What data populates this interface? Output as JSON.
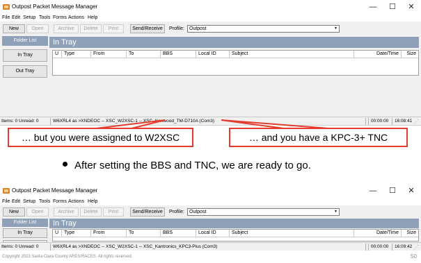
{
  "window_title": "Outpost Packet Message Manager",
  "window_controls": {
    "minimize": "—",
    "maximize": "☐",
    "close": "✕"
  },
  "menu": [
    "File",
    "Edit",
    "Setup",
    "Tools",
    "Forms",
    "Actions",
    "Help"
  ],
  "toolbar": {
    "new": "New",
    "open": "Open",
    "archive": "Archive",
    "delete": "Delete",
    "print": "Print",
    "send_receive": "Send/Receive",
    "profile_label": "Profile:",
    "profile_value": "Outpost"
  },
  "folder_list": {
    "header": "Folder List",
    "in_tray": "In Tray",
    "out_tray": "Out Tray"
  },
  "tray_title": "In Tray",
  "columns": [
    "U",
    "Type",
    "From",
    "To",
    "BBS",
    "Local ID",
    "Subject",
    "Date/Time",
    "Size"
  ],
  "screens": [
    {
      "status_items": "Items: 0   Unread: 0",
      "status_path": "W6XRL4 as >XNDEOC -- XSC_W2XSC-1 -- XSC_Kenwood_TM-D710A (Com3)",
      "status_elapsed": "00:00:00",
      "status_clock": "16:08:41"
    },
    {
      "status_items": "Items: 0   Unread: 0",
      "status_path": "W6XRL4 as >XNDEOC -- XSC_W2XSC-1 -- XSC_Kantronics_KPC3-Plus (Com3)",
      "status_elapsed": "00:00:00",
      "status_clock": "16:09:42"
    }
  ],
  "callouts": {
    "left": "… but you were assigned to W2XSC",
    "right": "… and you have a KPC-3+ TNC"
  },
  "bullet": "After setting the BBS and TNC, we are ready to go.",
  "footer": {
    "copyright": "Copyright 2023 Santa Clara County ARES/RACES.  All rights reserved.",
    "page": "50"
  },
  "colors": {
    "panel_header": "#8ea1b8",
    "callout_border": "#e33b2e",
    "window_bg": "#f0f0f0"
  }
}
